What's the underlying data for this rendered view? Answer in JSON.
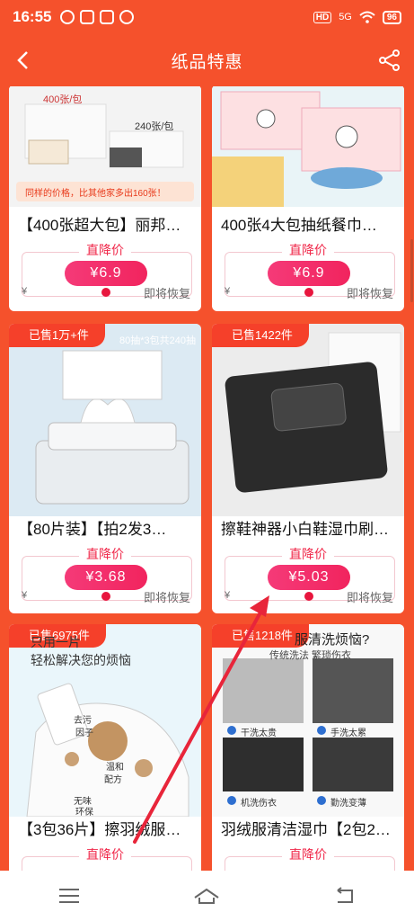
{
  "status_bar": {
    "time": "16:55",
    "hd": "HD",
    "network": "5G",
    "battery": "96"
  },
  "header": {
    "title": "纸品特惠"
  },
  "icons": {
    "back": "back-arrow-icon",
    "share": "share-icon"
  },
  "colors": {
    "brand": "#f5512c",
    "price_pink": "#f1245e",
    "badge_red": "#f5402a"
  },
  "products": [
    {
      "name": "【400张超大包】丽邦…",
      "badge": "",
      "price_label": "直降价",
      "price": "¥6.9",
      "yen": "¥",
      "restore": "即将恢复",
      "captions": [
        "400张/包",
        "240张/包",
        "同样的价格，比其他家多出160张！"
      ]
    },
    {
      "name": "400张4大包抽纸餐巾…",
      "badge": "",
      "price_label": "直降价",
      "price": "¥6.9",
      "yen": "¥",
      "restore": "即将恢复",
      "captions": []
    },
    {
      "name": "【80片装】【拍2发3…",
      "badge": "已售1万+件",
      "price_label": "直降价",
      "price": "¥3.68",
      "yen": "¥",
      "restore": "即将恢复",
      "captions": [
        "80抽*3包共240抽"
      ]
    },
    {
      "name": "擦鞋神器小白鞋湿巾刷…",
      "badge": "已售1422件",
      "price_label": "直降价",
      "price": "¥5.03",
      "yen": "¥",
      "restore": "即将恢复",
      "captions": []
    },
    {
      "name": "【3包36片】擦羽绒服…",
      "badge": "已售6975件",
      "price_label": "直降价",
      "captions": [
        "只用一片",
        "轻松解决您的烦恼",
        "去污",
        "因子",
        "温和",
        "配方",
        "无味",
        "环保"
      ]
    },
    {
      "name": "羽绒服清洁湿巾【2包2…",
      "badge": "已售1218件",
      "price_label": "直降价",
      "captions": [
        "服清洗烦恼?",
        "传统洗法 繁琐伤衣",
        "干洗太贵",
        "手洗太累",
        "机洗伤衣",
        "勤洗变薄"
      ]
    }
  ],
  "nav": {
    "menu": "menu-icon",
    "home": "home-icon",
    "back": "back-nav-icon"
  }
}
